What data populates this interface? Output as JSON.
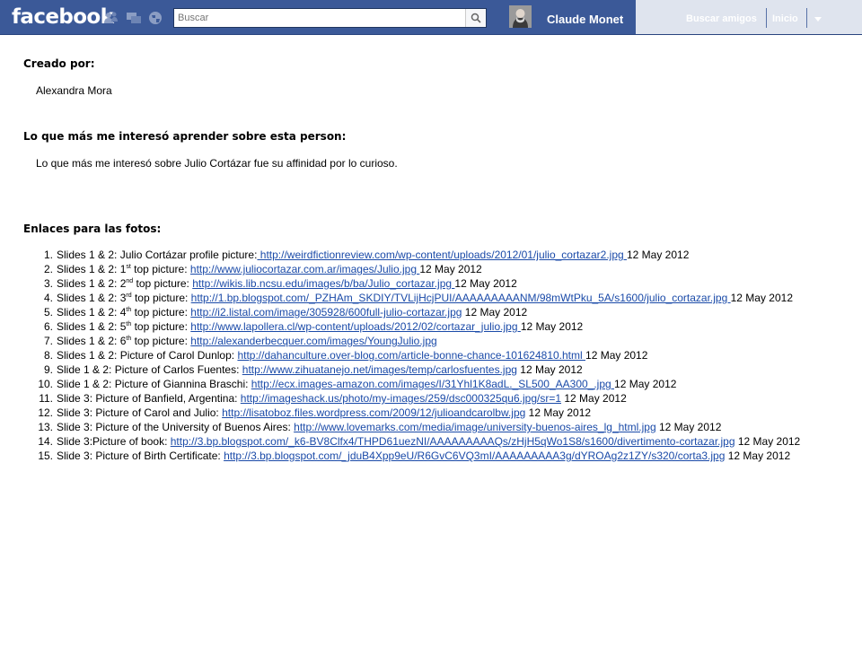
{
  "topbar": {
    "logo": "facebook",
    "search_placeholder": "Buscar",
    "user_name": "Claude Monet",
    "find_friends": "Buscar amigos",
    "home": "Inicio",
    "colors": {
      "bar": "#3b5998",
      "right_panel": "#dfe4ee"
    },
    "icons": [
      "friend-requests-icon",
      "messages-icon",
      "notifications-globe-icon",
      "search-icon",
      "account-menu-caret-icon"
    ]
  },
  "sections": {
    "created_by_heading": "Creado por:",
    "created_by_value": "Alexandra Mora",
    "interest_heading": "Lo que más me interesó aprender sobre esta person:",
    "interest_text": "Lo que más me interesó sobre Julio Cortázar fue su affinidad por lo curioso.",
    "links_heading": "Enlaces para las fotos:"
  },
  "links": [
    {
      "num": "1.",
      "pre": "Slides 1 & 2: Julio Cortázar profile picture:",
      "sup": "",
      "post": "",
      "url": " http://weirdfictionreview.com/wp-content/uploads/2012/01/julio_cortazar2.jpg ",
      "date": "12 May 2012"
    },
    {
      "num": "2.",
      "pre": "Slides 1 & 2: 1",
      "sup": "st",
      "post": " top picture: ",
      "url": "http://www.juliocortazar.com.ar/images/Julio.jpg ",
      "date": "12 May 2012"
    },
    {
      "num": "3.",
      "pre": "Slides 1 & 2: 2",
      "sup": "nd",
      "post": " top picture: ",
      "url": "http://wikis.lib.ncsu.edu/images/b/ba/Julio_cortazar.jpg ",
      "date": "12 May 2012"
    },
    {
      "num": "4.",
      "pre": "Slides 1 & 2: 3",
      "sup": "rd",
      "post": " top picture: ",
      "url": "http://1.bp.blogspot.com/_PZHAm_SKDIY/TVLijHcjPUI/AAAAAAAAANM/98mWtPku_5A/s1600/julio_cortazar.jpg ",
      "date": "12 May 2012"
    },
    {
      "num": "5.",
      "pre": "Slides 1 & 2: 4",
      "sup": "th",
      "post": " top picture: ",
      "url": "http://i2.listal.com/image/305928/600full-julio-cortazar.jpg",
      "date": "12 May 2012"
    },
    {
      "num": "6.",
      "pre": "Slides 1 & 2: 5",
      "sup": "th",
      "post": " top picture: ",
      "url": "http://www.lapollera.cl/wp-content/uploads/2012/02/cortazar_julio.jpg ",
      "date": "12 May 2012"
    },
    {
      "num": "7.",
      "pre": "Slides 1 & 2: 6",
      "sup": "th",
      "post": " top picture: ",
      "url": "http://alexanderbecquer.com/images/YoungJulio.jpg",
      "date": ""
    },
    {
      "num": "8.",
      "pre": "Slides 1 & 2: Picture of Carol Dunlop: ",
      "sup": "",
      "post": "",
      "url": "http://dahanculture.over-blog.com/article-bonne-chance-101624810.html ",
      "date": "12 May 2012"
    },
    {
      "num": "9.",
      "pre": "Slide 1 & 2: Picture of Carlos Fuentes: ",
      "sup": "",
      "post": "",
      "url": "http://www.zihuatanejo.net/images/temp/carlosfuentes.jpg",
      "date": "12 May 2012"
    },
    {
      "num": "10.",
      "pre": "Slide 1 & 2: Picture of Giannina Braschi: ",
      "sup": "",
      "post": "",
      "url": "http://ecx.images-amazon.com/images/I/31Yhl1K8adL._SL500_AA300_.jpg ",
      "date": "12 May 2012"
    },
    {
      "num": "11.",
      "pre": "Slide 3: Picture of Banfield, Argentina: ",
      "sup": "",
      "post": "",
      "url": "http://imageshack.us/photo/my-images/259/dsc000325qu6.jpg/sr=1",
      "date": "12 May 2012"
    },
    {
      "num": "12.",
      "pre": "Slide 3: Picture of Carol and Julio: ",
      "sup": "",
      "post": "",
      "url": "http://lisatoboz.files.wordpress.com/2009/12/julioandcarolbw.jpg",
      "date": "12 May 2012"
    },
    {
      "num": "13.",
      "pre": "Slide 3: Picture of the University of Buenos Aires: ",
      "sup": "",
      "post": "",
      "url": "http://www.lovemarks.com/media/image/university-buenos-aires_lg_html.jpg",
      "date": "12 May 2012"
    },
    {
      "num": "14.",
      "pre": "Slide 3:Picture of book: ",
      "sup": "",
      "post": "",
      "url": "http://3.bp.blogspot.com/_k6-BV8Clfx4/THPD61uezNI/AAAAAAAAAQs/zHjH5qWo1S8/s1600/divertimento-cortazar.jpg",
      "date": "12 May 2012"
    },
    {
      "num": "15.",
      "pre": "Slide 3: Picture of Birth Certificate: ",
      "sup": "",
      "post": "",
      "url": "http://3.bp.blogspot.com/_jduB4Xpp9eU/R6GvC6VQ3mI/AAAAAAAAA3g/dYROAg2z1ZY/s320/corta3.jpg",
      "date": "12 May 2012"
    }
  ]
}
